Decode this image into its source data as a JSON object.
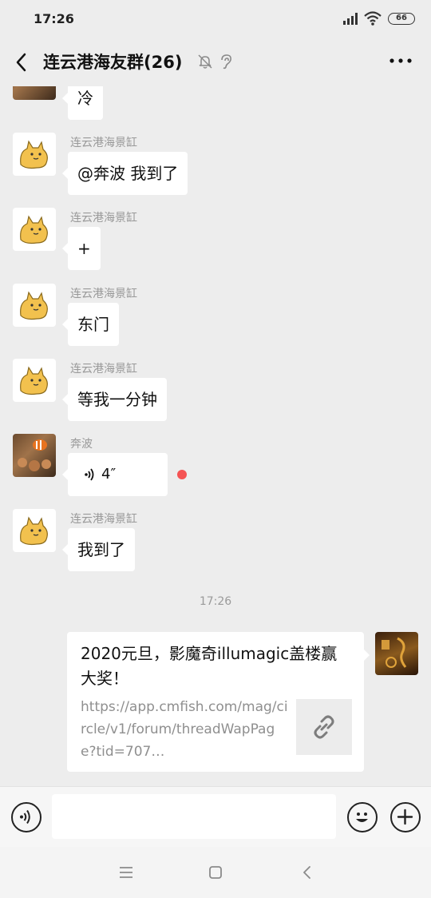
{
  "status_bar": {
    "time": "17:26",
    "battery": "66"
  },
  "header": {
    "title": "连云港海友群(26)"
  },
  "messages": [
    {
      "sender": "",
      "text": "冷"
    },
    {
      "sender": "连云港海景缸",
      "text": "@奔波  我到了"
    },
    {
      "sender": "连云港海景缸",
      "text": "+"
    },
    {
      "sender": "连云港海景缸",
      "text": "东门"
    },
    {
      "sender": "连云港海景缸",
      "text": "等我一分钟"
    },
    {
      "sender": "奔波",
      "duration": "4″"
    },
    {
      "sender": "连云港海景缸",
      "text": "我到了"
    }
  ],
  "timestamp": "17:26",
  "link_card": {
    "title": "2020元旦，影魔奇illumagic盖楼赢大奖！",
    "url": "https://app.cmfish.com/mag/circle/v1/forum/threadWapPage?tid=707…"
  },
  "icons": {
    "back": "back-arrow-icon",
    "mute": "bell-off-icon",
    "ear": "ear-icon",
    "more": "more-dots-icon",
    "voice": "voice-icon",
    "emoji": "emoji-icon",
    "plus": "plus-icon",
    "link": "link-icon"
  }
}
